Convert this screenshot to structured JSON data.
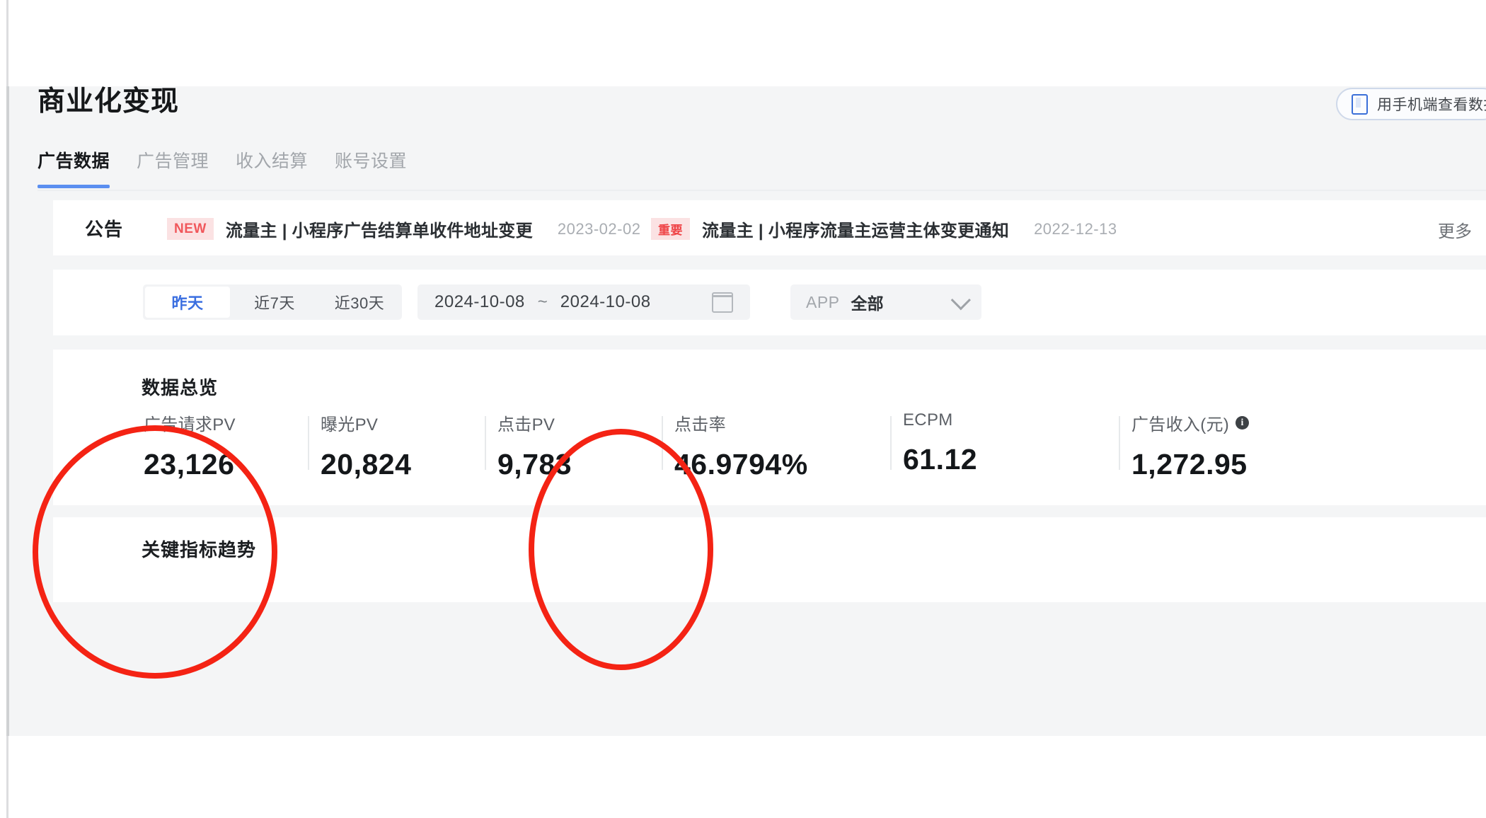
{
  "header": {
    "title": "商业化变现",
    "mobile_button": {
      "label": "用手机端查看数据",
      "icon": "mobile-phone-icon"
    }
  },
  "tabs": [
    {
      "label": "广告数据",
      "active": true
    },
    {
      "label": "广告管理",
      "active": false
    },
    {
      "label": "收入结算",
      "active": false
    },
    {
      "label": "账号设置",
      "active": false
    }
  ],
  "notice": {
    "label": "公告",
    "more": "更多",
    "items": [
      {
        "badge": "NEW",
        "badge_color": "#f0575b",
        "text": "流量主 | 小程序广告结算单收件地址变更",
        "date": "2023-02-02"
      },
      {
        "badge": "重要",
        "badge_color": "#ef4447",
        "text": "流量主 | 小程序流量主运营主体变更通知",
        "date": "2022-12-13"
      }
    ]
  },
  "filters": {
    "range_presets": [
      {
        "label": "昨天",
        "active": true
      },
      {
        "label": "近7天",
        "active": false
      },
      {
        "label": "近30天",
        "active": false
      }
    ],
    "date_start": "2024-10-08",
    "date_separator": "~",
    "date_end": "2024-10-08",
    "calendar_icon": "calendar-icon",
    "app_select": {
      "label": "APP",
      "value": "全部",
      "chevron": "chevron-down-icon"
    }
  },
  "overview": {
    "title": "数据总览",
    "metrics": [
      {
        "label": "广告请求PV",
        "value": "23,126",
        "info": false
      },
      {
        "label": "曝光PV",
        "value": "20,824",
        "info": false
      },
      {
        "label": "点击PV",
        "value": "9,783",
        "info": false
      },
      {
        "label": "点击率",
        "value": "46.9794%",
        "info": false
      },
      {
        "label": "ECPM",
        "value": "61.12",
        "info": false
      },
      {
        "label": "广告收入(元)",
        "value": "1,272.95",
        "info": true
      }
    ]
  },
  "trend": {
    "title": "关键指标趋势"
  },
  "annotations": {
    "color": "#f42314",
    "shapes": [
      {
        "type": "ellipse",
        "targets": "广告请求PV 23,126"
      },
      {
        "type": "ellipse",
        "targets": "点击PV 9,783"
      }
    ]
  }
}
